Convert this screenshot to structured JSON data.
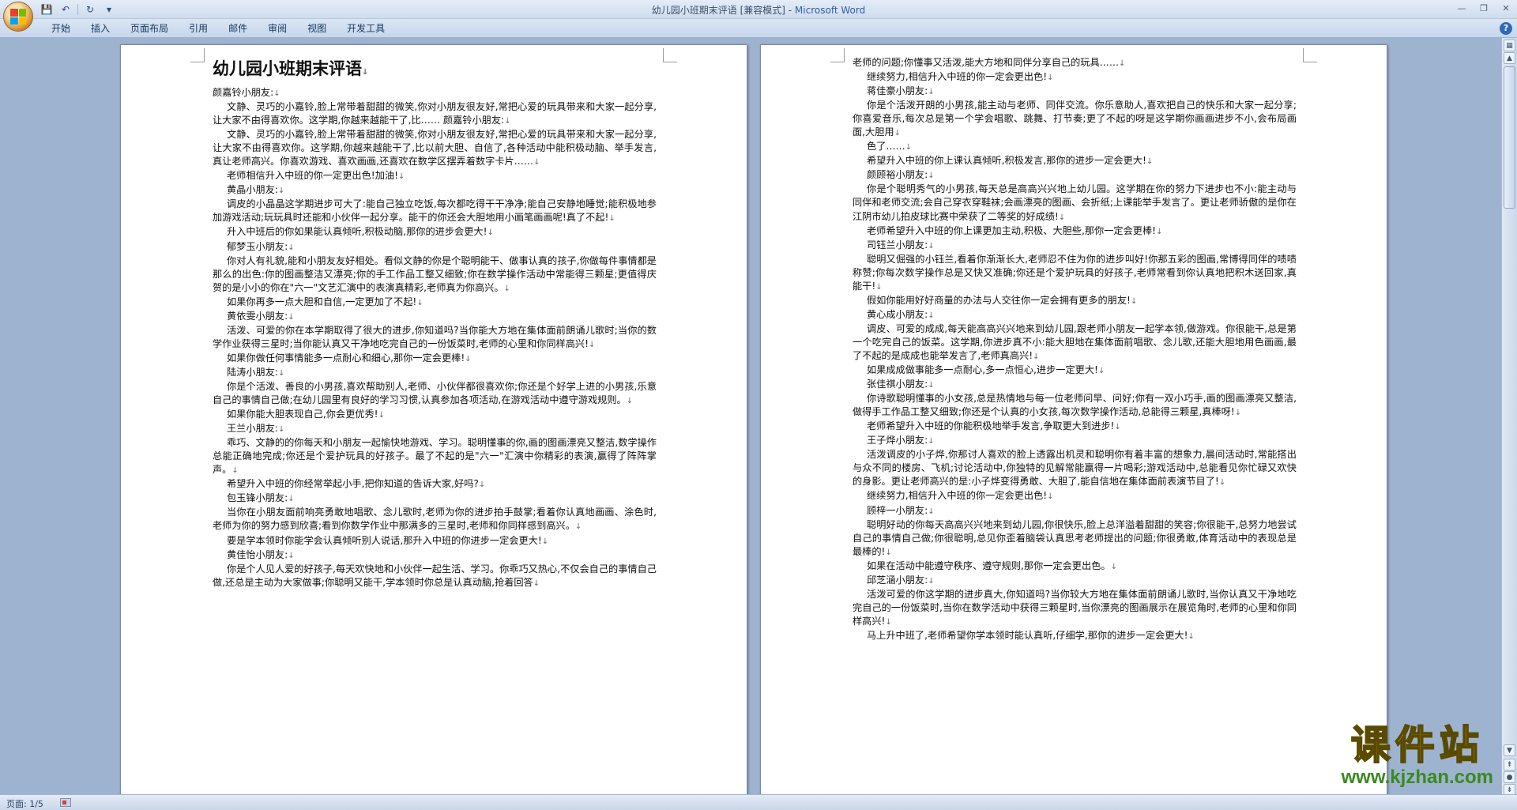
{
  "window": {
    "title": "幼儿园小班期末评语 [兼容模式] - ",
    "app_name": "Microsoft Word",
    "minimize": "—",
    "maximize": "❐",
    "close": "✕"
  },
  "quick_access": {
    "save_icon": "💾",
    "undo_icon": "↶",
    "redo_icon": "↻",
    "customize_icon": "▾"
  },
  "ribbon": {
    "tabs": [
      "开始",
      "插入",
      "页面布局",
      "引用",
      "邮件",
      "审阅",
      "视图",
      "开发工具"
    ],
    "help": "?"
  },
  "document": {
    "title": "幼儿园小班期末评语",
    "para_mark": "↓",
    "page_left": [
      {
        "t": "颜嘉铃小朋友:",
        "i": false
      },
      {
        "t": "文静、灵巧的小嘉铃,脸上常带着甜甜的微笑,你对小朋友很友好,常把心爱的玩具带来和大家一起分享,让大家不由得喜欢你。这学期,你越来越能干了,比…… 颜嘉铃小朋友:",
        "i": true
      },
      {
        "t": "文静、灵巧的小嘉铃,脸上常带着甜甜的微笑,你对小朋友很友好,常把心爱的玩具带来和大家一起分享,让大家不由得喜欢你。这学期,你越来越能干了,比以前大胆、自信了,各种活动中能积极动脑、举手发言,真让老师高兴。你喜欢游戏、喜欢画画,还喜欢在数学区摆弄着数字卡片……",
        "i": true
      },
      {
        "t": "老师相信升入中班的你一定更出色!加油!",
        "i": true
      },
      {
        "t": "黄晶小朋友:",
        "i": true
      },
      {
        "t": "调皮的小晶晶这学期进步可大了:能自己独立吃饭,每次都吃得干干净净;能自己安静地睡觉;能积极地参加游戏活动;玩玩具时还能和小伙伴一起分享。能干的你还会大胆地用小画笔画画呢!真了不起!",
        "i": true
      },
      {
        "t": "升入中班后的你如果能认真倾听,积极动脑,那你的进步会更大!",
        "i": true
      },
      {
        "t": "郁梦玉小朋友:",
        "i": true
      },
      {
        "t": "你对人有礼貌,能和小朋友友好相处。看似文静的你是个聪明能干、做事认真的孩子,你做每件事情都是那么的出色:你的图画整洁又漂亮;你的手工作品工整又细致;你在数学操作活动中常能得三颗星;更值得庆贺的是小小的你在\"六一\"文艺汇演中的表演真精彩,老师真为你高兴。",
        "i": true
      },
      {
        "t": "如果你再多一点大胆和自信,一定更加了不起!",
        "i": true
      },
      {
        "t": "黄依雯小朋友:",
        "i": true
      },
      {
        "t": "活泼、可爱的你在本学期取得了很大的进步,你知道吗?当你能大方地在集体面前朗诵儿歌时;当你的数学作业获得三星时;当你能认真又干净地吃完自己的一份饭菜时,老师的心里和你同样高兴!",
        "i": true
      },
      {
        "t": "如果你做任何事情能多一点耐心和细心,那你一定会更棒!",
        "i": true
      },
      {
        "t": "陆涛小朋友:",
        "i": true
      },
      {
        "t": "你是个活泼、善良的小男孩,喜欢帮助别人,老师、小伙伴都很喜欢你;你还是个好学上进的小男孩,乐意自己的事情自己做;在幼儿园里有良好的学习习惯,认真参加各项活动,在游戏活动中遵守游戏规则。",
        "i": true
      },
      {
        "t": "如果你能大胆表现自己,你会更优秀!",
        "i": true
      },
      {
        "t": "王兰小朋友:",
        "i": true
      },
      {
        "t": "乖巧、文静的的你每天和小朋友一起愉快地游戏、学习。聪明懂事的你,画的图画漂亮又整洁,数学操作总能正确地完成;你还是个爱护玩具的好孩子。最了不起的是\"六一\"汇演中你精彩的表演,赢得了阵阵掌声。",
        "i": true
      },
      {
        "t": "希望升入中班的你经常举起小手,把你知道的告诉大家,好吗?",
        "i": true
      },
      {
        "t": "包玉锋小朋友:",
        "i": true
      },
      {
        "t": "当你在小朋友面前响亮勇敢地唱歌、念儿歌时,老师为你的进步拍手鼓掌;看着你认真地画画、涂色时,老师为你的努力感到欣喜;看到你数学作业中那满多的三星时,老师和你同样感到高兴。",
        "i": true
      },
      {
        "t": "要是学本领时你能学会认真倾听别人说话,那升入中班的你进步一定会更大!",
        "i": true
      },
      {
        "t": "黄佳怡小朋友:",
        "i": true
      },
      {
        "t": "你是个人见人爱的好孩子,每天欢快地和小伙伴一起生活、学习。你乖巧又热心,不仅会自己的事情自己做,还总是主动为大家做事;你聪明又能干,学本领时你总是认真动脑,抢着回答",
        "i": true
      }
    ],
    "page_right": [
      {
        "t": "老师的问题;你懂事又活泼,能大方地和同伴分享自己的玩具……",
        "i": false
      },
      {
        "t": "继续努力,相信升入中班的你一定会更出色!",
        "i": true
      },
      {
        "t": "蒋佳豪小朋友:",
        "i": true
      },
      {
        "t": "你是个活泼开朗的小男孩,能主动与老师、同伴交流。你乐意助人,喜欢把自己的快乐和大家一起分享;你喜爱音乐,每次总是第一个学会唱歌、跳舞、打节奏;更了不起的呀是这学期你画画进步不小,会布局画面,大胆用",
        "i": true
      },
      {
        "t": "色了……",
        "i": true
      },
      {
        "t": "希望升入中班的你上课认真倾听,积极发言,那你的进步一定会更大!",
        "i": true
      },
      {
        "t": "颜顾裕小朋友:",
        "i": true
      },
      {
        "t": "你是个聪明秀气的小男孩,每天总是高高兴兴地上幼儿园。这学期在你的努力下进步也不小:能主动与同伴和老师交流;会自己穿衣穿鞋袜;会画漂亮的图画、会折纸;上课能举手发言了。更让老师骄傲的是你在江阴市幼儿拍皮球比赛中荣获了二等奖的好成绩!",
        "i": true
      },
      {
        "t": "老师希望升入中班的你上课更加主动,积极、大胆些,那你一定会更棒!",
        "i": true
      },
      {
        "t": "司钰兰小朋友:",
        "i": true
      },
      {
        "t": "聪明又倔强的小钰兰,看着你渐渐长大,老师忍不住为你的进步叫好!你那五彩的图画,常博得同伴的啧啧称赞;你每次数学操作总是又快又准确;你还是个爱护玩具的好孩子,老师常看到你认真地把积木送回家,真能干!",
        "i": true
      },
      {
        "t": "假如你能用好好商量的办法与人交往你一定会拥有更多的朋友!",
        "i": true
      },
      {
        "t": "黄心成小朋友:",
        "i": true
      },
      {
        "t": "调皮、可爱的成成,每天能高高兴兴地来到幼儿园,跟老师小朋友一起学本领,做游戏。你很能干,总是第一个吃完自己的饭菜。这学期,你进步真不小:能大胆地在集体面前唱歌、念儿歌,还能大胆地用色画画,最了不起的是成成也能举发言了,老师真高兴!",
        "i": true
      },
      {
        "t": "如果成成做事能多一点耐心,多一点恒心,进步一定更大!",
        "i": true
      },
      {
        "t": "张佳祺小朋友:",
        "i": true
      },
      {
        "t": "你诗歌聪明懂事的小女孩,总是热情地与每一位老师问早、问好;你有一双小巧手,画的图画漂亮又整洁,做得手工作品工整又细致;你还是个认真的小女孩,每次数学操作活动,总能得三颗星,真棒呀!",
        "i": true
      },
      {
        "t": "老师希望升入中班的你能积极地举手发言,争取更大到进步!",
        "i": true
      },
      {
        "t": "王子烨小朋友:",
        "i": true
      },
      {
        "t": "活泼调皮的小子烨,你那讨人喜欢的脸上透露出机灵和聪明你有着丰富的想象力,晨间活动时,常能搭出与众不同的楼房、飞机;讨论活动中,你独特的见解常能赢得一片喝彩;游戏活动中,总能看见你忙碌又欢快的身影。更让老师高兴的是:小子烨变得勇敢、大胆了,能自信地在集体面前表演节目了!",
        "i": true
      },
      {
        "t": "继续努力,相信升入中班的你一定会更出色!",
        "i": true
      },
      {
        "t": "顾梓一小朋友:",
        "i": true
      },
      {
        "t": "聪明好动的你每天高高兴兴地来到幼儿园,你很快乐,脸上总洋溢着甜甜的笑容;你很能干,总努力地尝试自己的事情自己做;你很聪明,总见你歪着脑袋认真思考老师提出的问题;你很勇敢,体育活动中的表现总是最棒的!",
        "i": true
      },
      {
        "t": "如果在活动中能遵守秩序、遵守规则,那你一定会更出色。",
        "i": true
      },
      {
        "t": "邱芝涵小朋友:",
        "i": true
      },
      {
        "t": "活泼可爱的你这学期的进步真大,你知道吗?当你较大方地在集体面前朗诵儿歌时,当你认真又干净地吃完自己的一份饭菜时,当你在数学活动中获得三颗星时,当你漂亮的图画展示在展览角时,老师的心里和你同样高兴!",
        "i": true
      },
      {
        "t": "马上升中班了,老师希望你学本领时能认真听,仔细学,那你的进步一定会更大!",
        "i": true
      }
    ]
  },
  "status": {
    "page": "页面: 1/5"
  },
  "watermark": {
    "main": "课件站",
    "url": "www.kjzhan.com"
  },
  "colors": {
    "canvas": "#9eb3cf",
    "title_app": "#2f5fa8",
    "watermark_yellow": "#f2d400",
    "watermark_green": "#3a8a1e"
  }
}
